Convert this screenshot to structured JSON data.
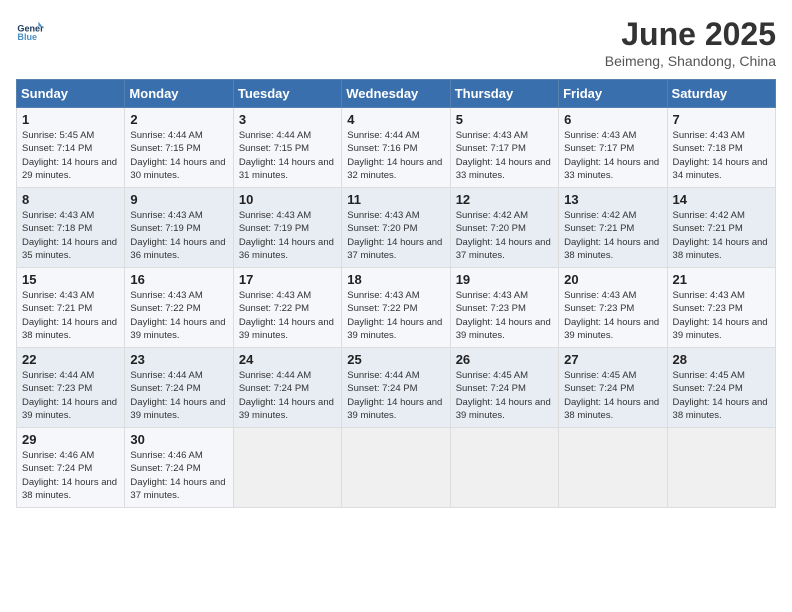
{
  "header": {
    "logo_line1": "General",
    "logo_line2": "Blue",
    "month_title": "June 2025",
    "subtitle": "Beimeng, Shandong, China"
  },
  "days_of_week": [
    "Sunday",
    "Monday",
    "Tuesday",
    "Wednesday",
    "Thursday",
    "Friday",
    "Saturday"
  ],
  "weeks": [
    [
      {
        "day": "1",
        "sunrise": "5:45 AM",
        "sunset": "7:14 PM",
        "daylight": "14 hours and 29 minutes."
      },
      {
        "day": "2",
        "sunrise": "4:44 AM",
        "sunset": "7:15 PM",
        "daylight": "14 hours and 30 minutes."
      },
      {
        "day": "3",
        "sunrise": "4:44 AM",
        "sunset": "7:15 PM",
        "daylight": "14 hours and 31 minutes."
      },
      {
        "day": "4",
        "sunrise": "4:44 AM",
        "sunset": "7:16 PM",
        "daylight": "14 hours and 32 minutes."
      },
      {
        "day": "5",
        "sunrise": "4:43 AM",
        "sunset": "7:17 PM",
        "daylight": "14 hours and 33 minutes."
      },
      {
        "day": "6",
        "sunrise": "4:43 AM",
        "sunset": "7:17 PM",
        "daylight": "14 hours and 33 minutes."
      },
      {
        "day": "7",
        "sunrise": "4:43 AM",
        "sunset": "7:18 PM",
        "daylight": "14 hours and 34 minutes."
      }
    ],
    [
      {
        "day": "8",
        "sunrise": "4:43 AM",
        "sunset": "7:18 PM",
        "daylight": "14 hours and 35 minutes."
      },
      {
        "day": "9",
        "sunrise": "4:43 AM",
        "sunset": "7:19 PM",
        "daylight": "14 hours and 36 minutes."
      },
      {
        "day": "10",
        "sunrise": "4:43 AM",
        "sunset": "7:19 PM",
        "daylight": "14 hours and 36 minutes."
      },
      {
        "day": "11",
        "sunrise": "4:43 AM",
        "sunset": "7:20 PM",
        "daylight": "14 hours and 37 minutes."
      },
      {
        "day": "12",
        "sunrise": "4:42 AM",
        "sunset": "7:20 PM",
        "daylight": "14 hours and 37 minutes."
      },
      {
        "day": "13",
        "sunrise": "4:42 AM",
        "sunset": "7:21 PM",
        "daylight": "14 hours and 38 minutes."
      },
      {
        "day": "14",
        "sunrise": "4:42 AM",
        "sunset": "7:21 PM",
        "daylight": "14 hours and 38 minutes."
      }
    ],
    [
      {
        "day": "15",
        "sunrise": "4:43 AM",
        "sunset": "7:21 PM",
        "daylight": "14 hours and 38 minutes."
      },
      {
        "day": "16",
        "sunrise": "4:43 AM",
        "sunset": "7:22 PM",
        "daylight": "14 hours and 39 minutes."
      },
      {
        "day": "17",
        "sunrise": "4:43 AM",
        "sunset": "7:22 PM",
        "daylight": "14 hours and 39 minutes."
      },
      {
        "day": "18",
        "sunrise": "4:43 AM",
        "sunset": "7:22 PM",
        "daylight": "14 hours and 39 minutes."
      },
      {
        "day": "19",
        "sunrise": "4:43 AM",
        "sunset": "7:23 PM",
        "daylight": "14 hours and 39 minutes."
      },
      {
        "day": "20",
        "sunrise": "4:43 AM",
        "sunset": "7:23 PM",
        "daylight": "14 hours and 39 minutes."
      },
      {
        "day": "21",
        "sunrise": "4:43 AM",
        "sunset": "7:23 PM",
        "daylight": "14 hours and 39 minutes."
      }
    ],
    [
      {
        "day": "22",
        "sunrise": "4:44 AM",
        "sunset": "7:23 PM",
        "daylight": "14 hours and 39 minutes."
      },
      {
        "day": "23",
        "sunrise": "4:44 AM",
        "sunset": "7:24 PM",
        "daylight": "14 hours and 39 minutes."
      },
      {
        "day": "24",
        "sunrise": "4:44 AM",
        "sunset": "7:24 PM",
        "daylight": "14 hours and 39 minutes."
      },
      {
        "day": "25",
        "sunrise": "4:44 AM",
        "sunset": "7:24 PM",
        "daylight": "14 hours and 39 minutes."
      },
      {
        "day": "26",
        "sunrise": "4:45 AM",
        "sunset": "7:24 PM",
        "daylight": "14 hours and 39 minutes."
      },
      {
        "day": "27",
        "sunrise": "4:45 AM",
        "sunset": "7:24 PM",
        "daylight": "14 hours and 38 minutes."
      },
      {
        "day": "28",
        "sunrise": "4:45 AM",
        "sunset": "7:24 PM",
        "daylight": "14 hours and 38 minutes."
      }
    ],
    [
      {
        "day": "29",
        "sunrise": "4:46 AM",
        "sunset": "7:24 PM",
        "daylight": "14 hours and 38 minutes."
      },
      {
        "day": "30",
        "sunrise": "4:46 AM",
        "sunset": "7:24 PM",
        "daylight": "14 hours and 37 minutes."
      },
      null,
      null,
      null,
      null,
      null
    ]
  ]
}
